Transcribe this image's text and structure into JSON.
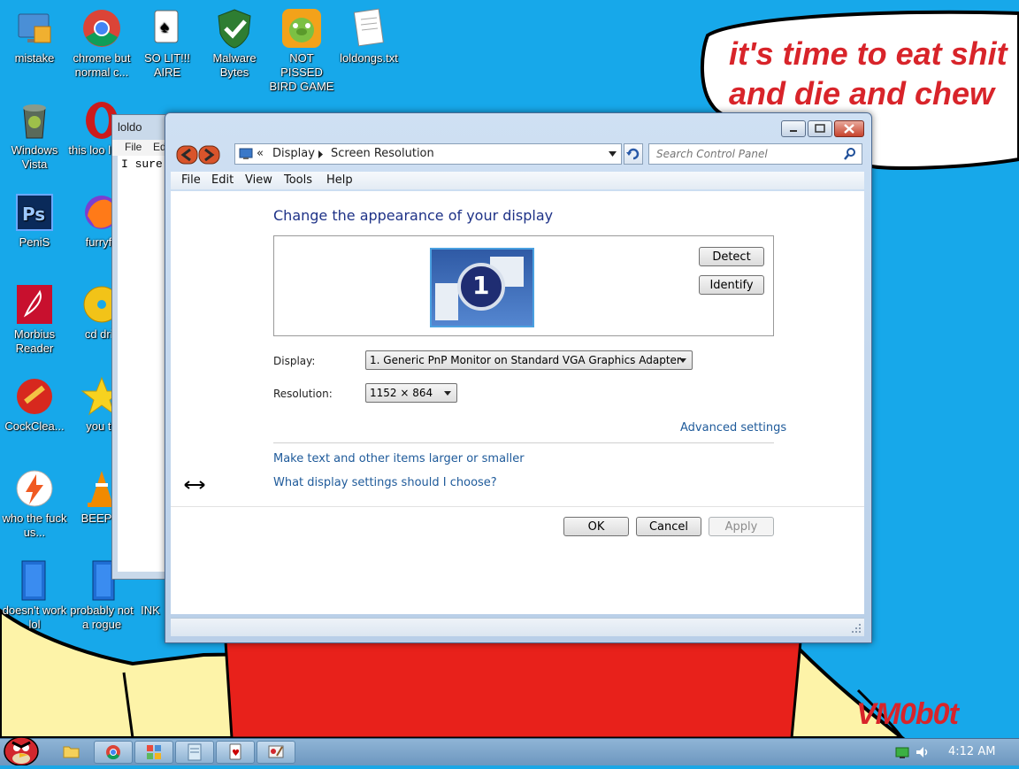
{
  "desktop": {
    "icons": [
      {
        "label": "mistake"
      },
      {
        "label": "chrome but normal c..."
      },
      {
        "label": "SO LIT!!! AIRE"
      },
      {
        "label": "Malware Bytes"
      },
      {
        "label": "NOT PISSED BIRD GAME"
      },
      {
        "label": "loldongs.txt"
      },
      {
        "label": "Windows Vista"
      },
      {
        "label": "this loo like a"
      },
      {
        "label": "PeniS"
      },
      {
        "label": "furryfo"
      },
      {
        "label": "Morbius Reader"
      },
      {
        "label": "cd driv"
      },
      {
        "label": "CockClea..."
      },
      {
        "label": "you tri"
      },
      {
        "label": "who the fuck us..."
      },
      {
        "label": "BEEP B"
      },
      {
        "label": "doesn't work lol"
      },
      {
        "label": "probably not a rogue"
      },
      {
        "label": "INK"
      }
    ],
    "wallpaper_text": "it's time to eat shit\nand die and chew\num",
    "signature": "VM0b0t"
  },
  "notepad": {
    "title": "loldo",
    "menu_file": "File",
    "menu_edit": "Ed",
    "text": "I sure"
  },
  "window": {
    "address": {
      "chevron": "«",
      "crumb1": "Display",
      "crumb2": "Screen Resolution"
    },
    "search_placeholder": "Search Control Panel",
    "menu": {
      "file": "File",
      "edit": "Edit",
      "view": "View",
      "tools": "Tools",
      "help": "Help"
    },
    "heading": "Change the appearance of your display",
    "monitor_number": "1",
    "detect_label": "Detect",
    "identify_label": "Identify",
    "display_label": "Display:",
    "display_value": "1. Generic PnP Monitor on Standard VGA Graphics Adapter",
    "resolution_label": "Resolution:",
    "resolution_value": "1152 × 864",
    "advanced_link": "Advanced settings",
    "link_text_size": "Make text and other items larger or smaller",
    "link_help": "What display settings should I choose?",
    "ok_label": "OK",
    "cancel_label": "Cancel",
    "apply_label": "Apply"
  },
  "taskbar": {
    "clock": "4:12 AM"
  },
  "colors": {
    "desktop_bg": "#17a8ea",
    "wallpaper_red": "#e8211b",
    "skin": "#fdf3a8",
    "heading_blue": "#1e3287",
    "link_blue": "#1e5a9a"
  }
}
